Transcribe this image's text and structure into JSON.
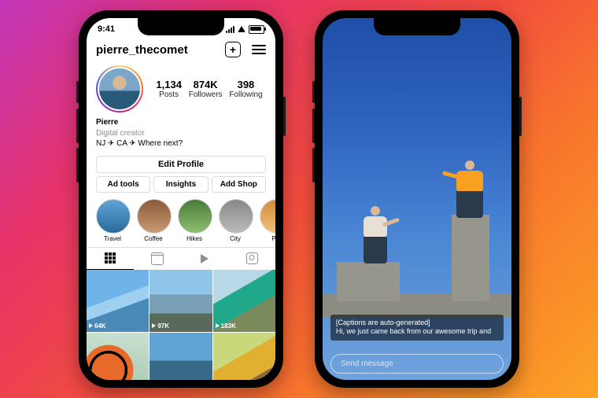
{
  "status": {
    "time": "9:41"
  },
  "profile": {
    "username": "pierre_thecomet",
    "stats": [
      {
        "n": "1,134",
        "l": "Posts"
      },
      {
        "n": "874K",
        "l": "Followers"
      },
      {
        "n": "398",
        "l": "Following"
      }
    ],
    "name": "Pierre",
    "category": "Digital creator",
    "bio_line": "NJ ✈ CA ✈ Where next?",
    "edit_label": "Edit Profile",
    "buttons": [
      "Ad tools",
      "Insights",
      "Add Shop"
    ],
    "highlights": [
      {
        "label": "Travel",
        "bg": "linear-gradient(#5fa4d4,#2b6a9e)"
      },
      {
        "label": "Coffee",
        "bg": "linear-gradient(#8a5a3a,#c79b72)"
      },
      {
        "label": "Hikes",
        "bg": "linear-gradient(#4a7a3a,#8fbf6f)"
      },
      {
        "label": "City",
        "bg": "linear-gradient(#888,#bbb)"
      },
      {
        "label": "Pla",
        "bg": "linear-gradient(#d48a3a,#f0c27a)"
      }
    ],
    "posts": [
      {
        "views": "64K",
        "bg": "linear-gradient(160deg,#6fb4e8 0 45%,#9fd0f0 45% 60%,#4a8ab8 60%)"
      },
      {
        "views": "97K",
        "bg": "linear-gradient(180deg,#8fc5e8 0 40%,#7aa0b8 40% 70%,#5a6a5a 70%)"
      },
      {
        "views": "183K",
        "bg": "linear-gradient(150deg,#b8d8e8 0 35%,#1fa88a 35% 62%,#7a8a5a 62%)"
      },
      {
        "views": "",
        "bg": "radial-gradient(circle at 35% 60%,#e86a2a 0 30%,#000 30% 35%,#e86a2a 35% 45%,transparent 46%),linear-gradient(#c8e0d0,#a8c8b0)"
      },
      {
        "views": "",
        "bg": "linear-gradient(180deg,#5fa4d4 0 45%,#3a6a8a 45%)"
      },
      {
        "views": "",
        "bg": "linear-gradient(150deg,#c8d87a 0 40%,#e0b030 40% 70%,#8a6a3a 70%)"
      }
    ]
  },
  "story": {
    "caption": "[Captions are auto-generated]\nHi, we just came back from our awesome trip and",
    "message_placeholder": "Send message"
  },
  "colors": {
    "person1_top": "#e8e0d4",
    "person2_top": "#f8a020"
  }
}
